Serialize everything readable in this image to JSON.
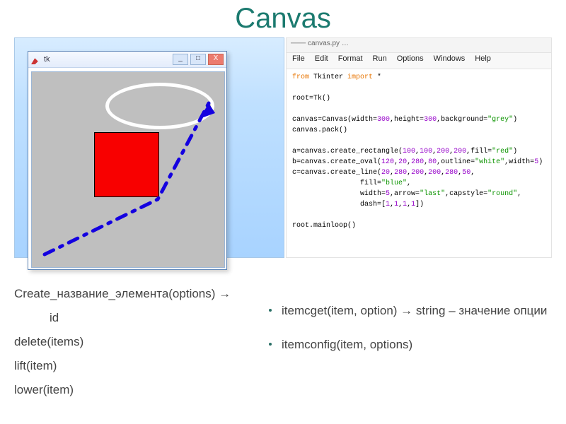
{
  "title": "Canvas",
  "tk": {
    "label": "tk",
    "min": "_",
    "max": "□",
    "close": "X"
  },
  "editor": {
    "top": "─── canvas.py …",
    "menu": [
      "File",
      "Edit",
      "Format",
      "Run",
      "Options",
      "Windows",
      "Help"
    ],
    "code": {
      "l1a": "from",
      "l1b": " Tkinter ",
      "l1c": "import",
      "l1d": " *",
      "l2": "root=Tk()",
      "l3a": "canvas=Canvas(width=",
      "l3b": "300",
      "l3c": ",height=",
      "l3d": "300",
      "l3e": ",background=",
      "l3f": "\"grey\"",
      "l3g": ")",
      "l4": "canvas.pack()",
      "l5a": "a=canvas.create_rectangle(",
      "l5b": "100",
      "l5c": ",",
      "l5d": "100",
      "l5e": ",",
      "l5f": "200",
      "l5g": ",",
      "l5h": "200",
      "l5i": ",fill=",
      "l5j": "\"red\"",
      "l5k": ")",
      "l6a": "b=canvas.create_oval(",
      "l6b": "120",
      "l6c": ",",
      "l6d": "20",
      "l6e": ",",
      "l6f": "280",
      "l6g": ",",
      "l6h": "80",
      "l6i": ",outline=",
      "l6j": "\"white\"",
      "l6k": ",width=",
      "l6l": "5",
      "l6m": ")",
      "l7a": "c=canvas.create_line(",
      "l7b": "20",
      "l7c": ",",
      "l7d": "280",
      "l7e": ",",
      "l7f": "200",
      "l7g": ",",
      "l7h": "200",
      "l7i": ",",
      "l7j": "280",
      "l7k": ",",
      "l7l": "50",
      "l7m": ",",
      "l8a": "                fill=",
      "l8b": "\"blue\"",
      "l8c": ",",
      "l9a": "                width=",
      "l9b": "5",
      "l9c": ",arrow=",
      "l9d": "\"last\"",
      "l9e": ",capstyle=",
      "l9f": "\"round\"",
      "l9g": ",",
      "l10a": "                dash=[",
      "l10b": "1",
      "l10c": ",",
      "l10d": "1",
      "l10e": ",",
      "l10f": "1",
      "l10g": ",",
      "l10h": "1",
      "l10i": "])",
      "l11": "root.mainloop()"
    }
  },
  "methods": {
    "left": {
      "create": "Create_название_элемента(options) →",
      "id": "id",
      "del": "delete(items)",
      "lift": "lift(item)",
      "lower": "lower(item)"
    },
    "right": {
      "itemcget": "itemcget(item, option) → string – значение опции",
      "itemconfig": "itemconfig(item, options)"
    }
  }
}
